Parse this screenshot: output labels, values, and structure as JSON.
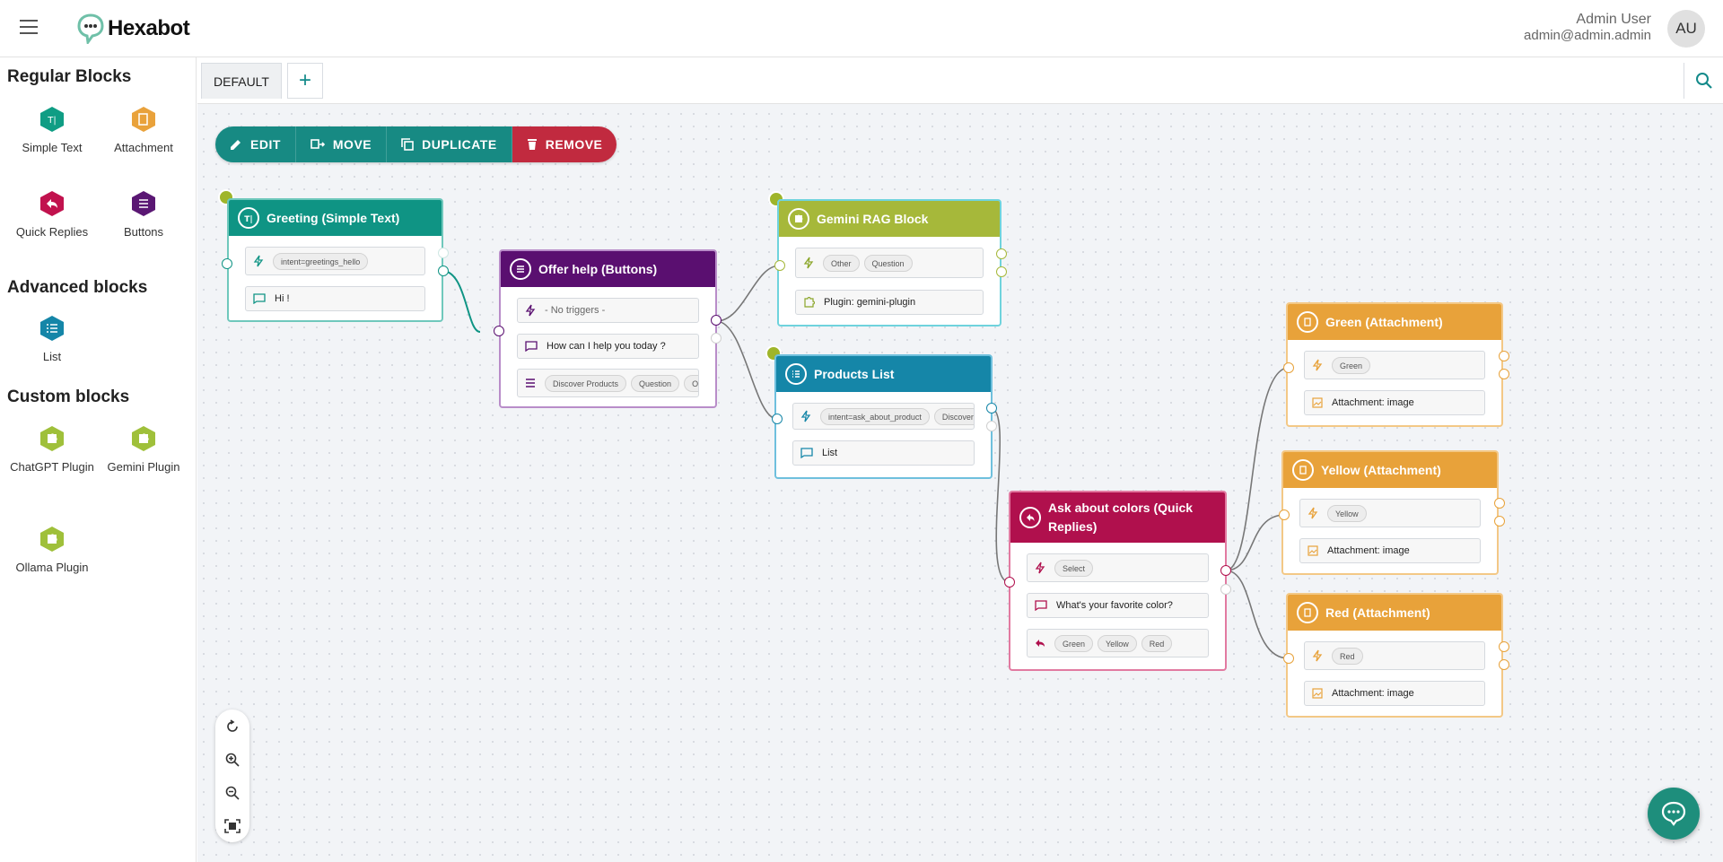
{
  "app": {
    "name": "Hexabot"
  },
  "user": {
    "name": "Admin User",
    "email": "admin@admin.admin",
    "initials": "AU"
  },
  "sidebar": {
    "regular_title": "Regular Blocks",
    "advanced_title": "Advanced blocks",
    "custom_title": "Custom blocks",
    "regular": [
      {
        "label": "Simple Text",
        "color": "#0f9d84"
      },
      {
        "label": "Attachment",
        "color": "#e9a23b"
      },
      {
        "label": "Quick Replies",
        "color": "#c1124e"
      },
      {
        "label": "Buttons",
        "color": "#5a1773"
      }
    ],
    "advanced": [
      {
        "label": "List",
        "color": "#1586a8"
      }
    ],
    "custom": [
      {
        "label": "ChatGPT Plugin",
        "color": "#9fc03a"
      },
      {
        "label": "Gemini Plugin",
        "color": "#9fc03a"
      },
      {
        "label": "Ollama Plugin",
        "color": "#9fc03a"
      }
    ]
  },
  "tabs": {
    "active": "DEFAULT",
    "add": "+"
  },
  "toolbar": {
    "edit": "EDIT",
    "move": "MOVE",
    "duplicate": "DUPLICATE",
    "remove": "REMOVE"
  },
  "nodes": {
    "greeting": {
      "title": "Greeting (Simple Text)",
      "color": "#0f9484",
      "trigger": "intent=greetings_hello",
      "message": "Hi !"
    },
    "offer": {
      "title": "Offer help (Buttons)",
      "color": "#5a0f70",
      "trigger": "- No triggers -",
      "message": "How can I help you today ?",
      "buttons": [
        "Discover Products",
        "Question",
        "Oth"
      ]
    },
    "gemini": {
      "title": "Gemini RAG Block",
      "color": "#a6b83a",
      "triggers": [
        "Other",
        "Question"
      ],
      "plugin": "Plugin: gemini-plugin"
    },
    "products": {
      "title": "Products List",
      "color": "#1586a8",
      "triggers": [
        "intent=ask_about_product",
        "Discover Pr"
      ],
      "message": "List"
    },
    "colors": {
      "title": "Ask about colors (Quick Replies)",
      "color": "#b0104d",
      "trigger": "Select",
      "message": "What's your favorite color?",
      "replies": [
        "Green",
        "Yellow",
        "Red"
      ]
    },
    "green": {
      "title": "Green (Attachment)",
      "color": "#e8a23a",
      "trigger": "Green",
      "attachment": "Attachment: image"
    },
    "yellow": {
      "title": "Yellow (Attachment)",
      "color": "#e8a23a",
      "trigger": "Yellow",
      "attachment": "Attachment: image"
    },
    "red": {
      "title": "Red (Attachment)",
      "color": "#e8a23a",
      "trigger": "Red",
      "attachment": "Attachment: image"
    }
  }
}
